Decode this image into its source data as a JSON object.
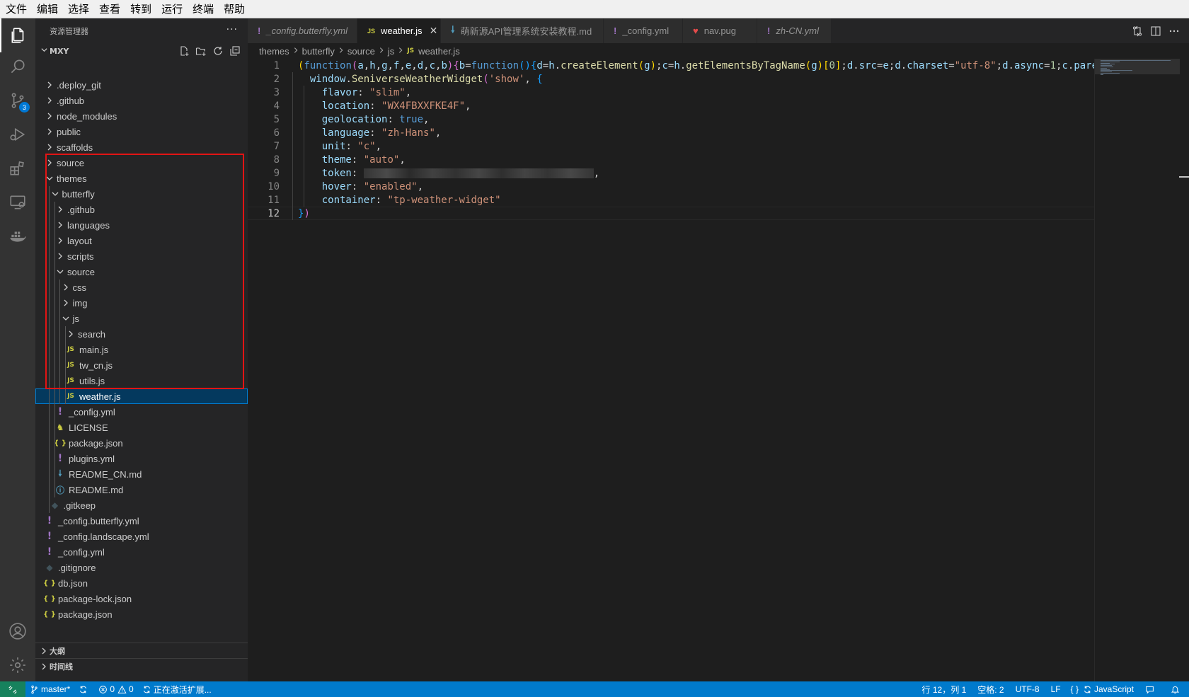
{
  "menubar": {
    "items": [
      "文件",
      "编辑",
      "选择",
      "查看",
      "转到",
      "运行",
      "终端",
      "帮助"
    ]
  },
  "activitybar": {
    "scm_badge": "3"
  },
  "sidebar": {
    "title": "资源管理器",
    "more": "···",
    "folder_name": "MXY",
    "tree": [
      {
        "label": ".deploy_git",
        "type": "folder"
      },
      {
        "label": ".github",
        "type": "folder"
      },
      {
        "label": "node_modules",
        "type": "folder"
      },
      {
        "label": "public",
        "type": "folder"
      },
      {
        "label": "scaffolds",
        "type": "folder"
      },
      {
        "label": "source",
        "type": "folder"
      },
      {
        "label": "themes",
        "type": "folder-open"
      },
      {
        "label": "butterfly",
        "type": "folder-open"
      },
      {
        "label": ".github",
        "type": "folder"
      },
      {
        "label": "languages",
        "type": "folder"
      },
      {
        "label": "layout",
        "type": "folder"
      },
      {
        "label": "scripts",
        "type": "folder"
      },
      {
        "label": "source",
        "type": "folder-open"
      },
      {
        "label": "css",
        "type": "folder"
      },
      {
        "label": "img",
        "type": "folder"
      },
      {
        "label": "js",
        "type": "folder-open"
      },
      {
        "label": "search",
        "type": "folder"
      },
      {
        "label": "main.js",
        "type": "js"
      },
      {
        "label": "tw_cn.js",
        "type": "js"
      },
      {
        "label": "utils.js",
        "type": "js"
      },
      {
        "label": "weather.js",
        "type": "js"
      },
      {
        "label": "_config.yml",
        "type": "yml"
      },
      {
        "label": "LICENSE",
        "type": "license"
      },
      {
        "label": "package.json",
        "type": "json"
      },
      {
        "label": "plugins.yml",
        "type": "yml"
      },
      {
        "label": "README_CN.md",
        "type": "md"
      },
      {
        "label": "README.md",
        "type": "info"
      },
      {
        "label": ".gitkeep",
        "type": "git"
      },
      {
        "label": "_config.butterfly.yml",
        "type": "yml"
      },
      {
        "label": "_config.landscape.yml",
        "type": "yml"
      },
      {
        "label": "_config.yml",
        "type": "yml"
      },
      {
        "label": ".gitignore",
        "type": "git"
      },
      {
        "label": "db.json",
        "type": "json"
      },
      {
        "label": "package-lock.json",
        "type": "json"
      },
      {
        "label": "package.json",
        "type": "json"
      }
    ],
    "outline_label": "大纲",
    "timeline_label": "时间线"
  },
  "icons": {
    "js": "JS",
    "yml": "!",
    "json": "{ }",
    "md": "🠗",
    "git": "◆",
    "license": "♞",
    "info": "ⓘ"
  },
  "tabs": [
    {
      "label": "_config.butterfly.yml",
      "icon": "yml",
      "active": false,
      "italic": true
    },
    {
      "label": "weather.js",
      "icon": "js",
      "active": true,
      "italic": false
    },
    {
      "label": "萌新源API管理系统安装教程.md",
      "icon": "md",
      "active": false,
      "italic": false
    },
    {
      "label": "_config.yml",
      "icon": "yml",
      "active": false,
      "italic": false
    },
    {
      "label": "nav.pug",
      "icon": "pug",
      "active": false,
      "italic": false
    },
    {
      "label": "zh-CN.yml",
      "icon": "yml",
      "active": false,
      "italic": true
    }
  ],
  "tab_close": "✕",
  "breadcrumb": [
    "themes",
    "butterfly",
    "source",
    "js",
    "weather.js"
  ],
  "editor": {
    "line_numbers": [
      "1",
      "2",
      "3",
      "4",
      "5",
      "6",
      "7",
      "8",
      "9",
      "10",
      "11",
      "12"
    ],
    "current_line": 12,
    "lines": [
      [
        [
          "p1",
          "("
        ],
        [
          "kw",
          "function"
        ],
        [
          "p2",
          "("
        ],
        [
          "var",
          "a"
        ],
        [
          "def",
          ","
        ],
        [
          "var",
          "h"
        ],
        [
          "def",
          ","
        ],
        [
          "var",
          "g"
        ],
        [
          "def",
          ","
        ],
        [
          "var",
          "f"
        ],
        [
          "def",
          ","
        ],
        [
          "var",
          "e"
        ],
        [
          "def",
          ","
        ],
        [
          "var",
          "d"
        ],
        [
          "def",
          ","
        ],
        [
          "var",
          "c"
        ],
        [
          "def",
          ","
        ],
        [
          "var",
          "b"
        ],
        [
          "p2",
          ")"
        ],
        [
          "p2",
          "{"
        ],
        [
          "var",
          "b"
        ],
        [
          "def",
          "="
        ],
        [
          "kw",
          "function"
        ],
        [
          "p3",
          "()"
        ],
        [
          "p3",
          "{"
        ],
        [
          "var",
          "d"
        ],
        [
          "def",
          "="
        ],
        [
          "var",
          "h"
        ],
        [
          "def",
          "."
        ],
        [
          "fn",
          "createElement"
        ],
        [
          "p1",
          "("
        ],
        [
          "var",
          "g"
        ],
        [
          "p1",
          ")"
        ],
        [
          "def",
          ";"
        ],
        [
          "var",
          "c"
        ],
        [
          "def",
          "="
        ],
        [
          "var",
          "h"
        ],
        [
          "def",
          "."
        ],
        [
          "fn",
          "getElementsByTagName"
        ],
        [
          "p1",
          "("
        ],
        [
          "var",
          "g"
        ],
        [
          "p1",
          ")"
        ],
        [
          "p1",
          "["
        ],
        [
          "num",
          "0"
        ],
        [
          "p1",
          "]"
        ],
        [
          "def",
          ";"
        ],
        [
          "var",
          "d"
        ],
        [
          "def",
          "."
        ],
        [
          "var",
          "src"
        ],
        [
          "def",
          "="
        ],
        [
          "var",
          "e"
        ],
        [
          "def",
          ";"
        ],
        [
          "var",
          "d"
        ],
        [
          "def",
          "."
        ],
        [
          "var",
          "charset"
        ],
        [
          "def",
          "="
        ],
        [
          "str",
          "\"utf-8\""
        ],
        [
          "def",
          ";"
        ],
        [
          "var",
          "d"
        ],
        [
          "def",
          "."
        ],
        [
          "var",
          "async"
        ],
        [
          "def",
          "="
        ],
        [
          "num",
          "1"
        ],
        [
          "def",
          ";"
        ],
        [
          "var",
          "c"
        ],
        [
          "def",
          "."
        ],
        [
          "var",
          "pare"
        ]
      ],
      [
        [
          "def",
          "  "
        ],
        [
          "var",
          "window"
        ],
        [
          "def",
          "."
        ],
        [
          "fn",
          "SeniverseWeatherWidget"
        ],
        [
          "p2",
          "("
        ],
        [
          "str",
          "'show'"
        ],
        [
          "def",
          ", "
        ],
        [
          "p3",
          "{"
        ]
      ],
      [
        [
          "def",
          "    "
        ],
        [
          "var",
          "flavor"
        ],
        [
          "def",
          ": "
        ],
        [
          "str",
          "\"slim\""
        ],
        [
          "def",
          ","
        ]
      ],
      [
        [
          "def",
          "    "
        ],
        [
          "var",
          "location"
        ],
        [
          "def",
          ": "
        ],
        [
          "str",
          "\"WX4FBXXFKE4F\""
        ],
        [
          "def",
          ","
        ]
      ],
      [
        [
          "def",
          "    "
        ],
        [
          "var",
          "geolocation"
        ],
        [
          "def",
          ": "
        ],
        [
          "kw",
          "true"
        ],
        [
          "def",
          ","
        ]
      ],
      [
        [
          "def",
          "    "
        ],
        [
          "var",
          "language"
        ],
        [
          "def",
          ": "
        ],
        [
          "str",
          "\"zh-Hans\""
        ],
        [
          "def",
          ","
        ]
      ],
      [
        [
          "def",
          "    "
        ],
        [
          "var",
          "unit"
        ],
        [
          "def",
          ": "
        ],
        [
          "str",
          "\"c\""
        ],
        [
          "def",
          ","
        ]
      ],
      [
        [
          "def",
          "    "
        ],
        [
          "var",
          "theme"
        ],
        [
          "def",
          ": "
        ],
        [
          "str",
          "\"auto\""
        ],
        [
          "def",
          ","
        ]
      ],
      [
        [
          "def",
          "    "
        ],
        [
          "var",
          "token"
        ],
        [
          "def",
          ": "
        ],
        [
          "blur",
          ""
        ],
        [
          "def",
          ","
        ]
      ],
      [
        [
          "def",
          "    "
        ],
        [
          "var",
          "hover"
        ],
        [
          "def",
          ": "
        ],
        [
          "str",
          "\"enabled\""
        ],
        [
          "def",
          ","
        ]
      ],
      [
        [
          "def",
          "    "
        ],
        [
          "var",
          "container"
        ],
        [
          "def",
          ": "
        ],
        [
          "str",
          "\"tp-weather-widget\""
        ]
      ],
      [
        [
          "p3",
          "}"
        ],
        [
          "p2",
          ")"
        ]
      ]
    ]
  },
  "statusbar": {
    "branch": "master*",
    "errors": "0",
    "warnings": "0",
    "activating": "正在激活扩展...",
    "position": "行 12，列 1",
    "spaces": "空格: 2",
    "encoding": "UTF-8",
    "eol": "LF",
    "language": "JavaScript"
  },
  "colors": {
    "accent": "#007acc",
    "selection": "#04395e",
    "highlight_box": "#e21414"
  }
}
